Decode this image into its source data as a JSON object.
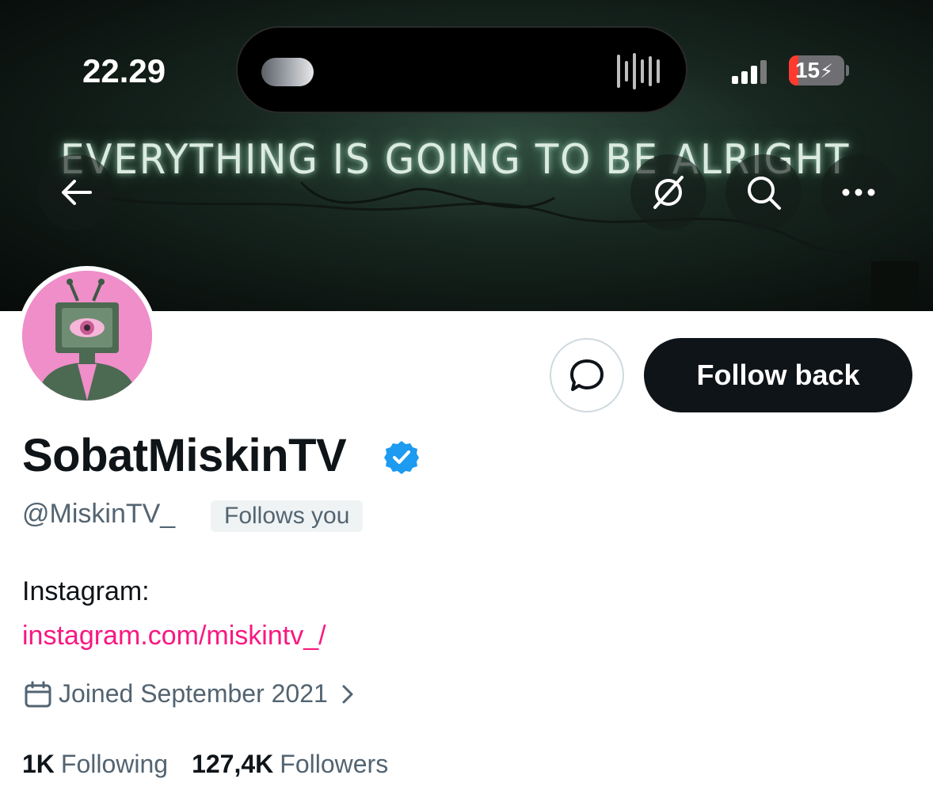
{
  "status_bar": {
    "time": "22.29",
    "battery": "15"
  },
  "banner": {
    "neon_text": "EVERYTHING IS GOING TO BE ALRIGHT"
  },
  "header_actions": {
    "back_icon": "arrow-left-icon",
    "grok_icon": "grok-icon",
    "search_icon": "search-icon",
    "more_icon": "ellipsis-icon"
  },
  "profile": {
    "display_name": "SobatMiskinTV",
    "verified": true,
    "handle": "@MiskinTV_",
    "follows_you": "Follows you",
    "bio_label": "Instagram:",
    "bio_link": "instagram.com/miskintv_/",
    "joined": "Joined September 2021",
    "following_count": "1K",
    "following_label": "Following",
    "followers_count": "127,4K",
    "followers_label": "Followers"
  },
  "actions": {
    "message_icon": "message-bubble-icon",
    "follow_back": "Follow back"
  },
  "colors": {
    "accent_dark": "#0f1419",
    "link": "#f91880",
    "verified": "#1d9bf0",
    "secondary_text": "#536471"
  }
}
